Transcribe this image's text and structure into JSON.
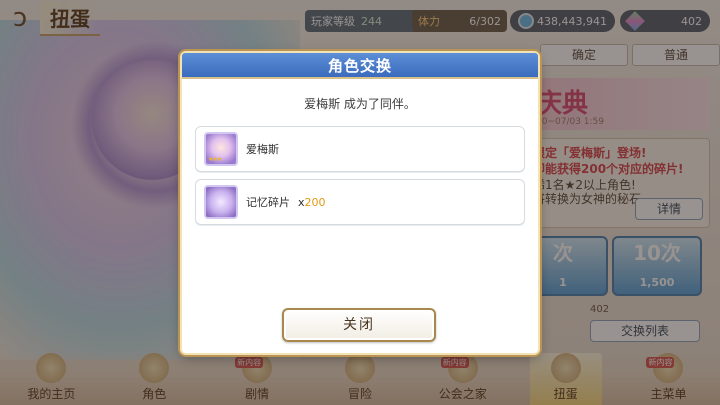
{
  "header": {
    "title": "扭蛋"
  },
  "hud": {
    "level_label": "玩家等级",
    "level_value": "244",
    "stamina_label": "体力",
    "stamina_value": "6/302",
    "money": "438,443,941",
    "gems": "402"
  },
  "tabs": [
    "确定",
    "普通"
  ],
  "banner": {
    "title": "庆典",
    "date": "00~07/03 1:59"
  },
  "gacha_info": {
    "line1": "限定「爱梅斯」登场!",
    "line2": "即能获得200个对应的碎片!",
    "line3": "稀1名★2以上角色!",
    "line4": "将转换为女神的秘石。",
    "detail_button": "详情"
  },
  "pulls": [
    {
      "label": "次",
      "count": "1",
      "cost": ""
    },
    {
      "label": "10次",
      "count": "",
      "cost": "1,500"
    }
  ],
  "gem_small": "402",
  "exchange_button": "交换列表",
  "nav": [
    {
      "label": "我的主页",
      "badge": ""
    },
    {
      "label": "角色",
      "badge": ""
    },
    {
      "label": "剧情",
      "badge": "新内容"
    },
    {
      "label": "冒险",
      "badge": ""
    },
    {
      "label": "公会之家",
      "badge": "新内容"
    },
    {
      "label": "扭蛋",
      "badge": ""
    },
    {
      "label": "主菜单",
      "badge": "新内容"
    }
  ],
  "dialog": {
    "title": "角色交换",
    "message": "爱梅斯 成为了同伴。",
    "rewards": [
      {
        "name": "爱梅斯",
        "quantity": ""
      },
      {
        "name": "记忆碎片",
        "quantity_prefix": "x",
        "quantity": "200"
      }
    ],
    "close_button": "关闭"
  },
  "colors": {
    "dialog_header": "#3b6bbd",
    "quantity_accent": "#e19a13"
  }
}
